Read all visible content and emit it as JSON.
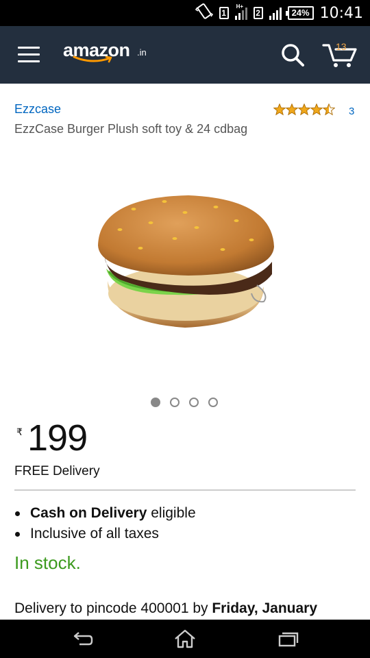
{
  "status_bar": {
    "sim1": "1",
    "sim1_network": "H+",
    "sim2": "2",
    "battery": "24%",
    "time": "10:41",
    "icons": [
      "vibrate-icon",
      "signal-icon",
      "battery-icon"
    ]
  },
  "header": {
    "logo_word": "amazon",
    "logo_suffix": ".in",
    "cart_count": "13",
    "icons": [
      "menu-icon",
      "search-icon",
      "cart-icon"
    ]
  },
  "product": {
    "brand": "Ezzcase",
    "title": "EzzCase Burger Plush soft toy & 24 cdbag",
    "rating_stars": 4.5,
    "rating_count": "3",
    "image_count": 4,
    "active_image": 1,
    "currency_symbol": "₹",
    "price": "199",
    "delivery": "FREE Delivery",
    "bullets": [
      {
        "bold": "Cash on Delivery",
        "rest": " eligible"
      },
      {
        "bold": "",
        "rest": "Inclusive of all taxes"
      }
    ],
    "stock": "In stock.",
    "delivery_prefix": "Delivery to pincode 400001 by ",
    "delivery_date": "Friday, January"
  },
  "colors": {
    "header_bg": "#232f3e",
    "link": "#0066c0",
    "in_stock": "#3c9a1e",
    "star": "#f0a81c",
    "cart_count": "#f3a847"
  },
  "nav_bar": {
    "icons": [
      "back-icon",
      "home-icon",
      "recent-apps-icon"
    ]
  }
}
